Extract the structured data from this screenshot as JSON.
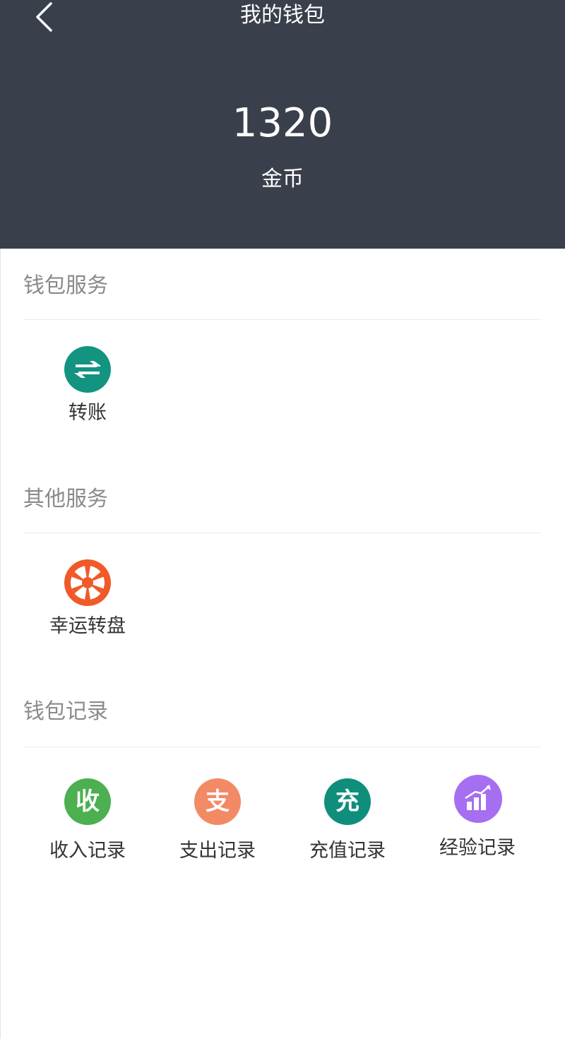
{
  "nav": {
    "title": "我的钱包",
    "back_icon": "chevron-left-icon"
  },
  "wallet": {
    "balance": "1320",
    "unit": "金币"
  },
  "sections": [
    {
      "title": "钱包服务",
      "items": [
        {
          "label": "转账",
          "icon": "transfer-icon",
          "color": "#129481"
        }
      ]
    },
    {
      "title": "其他服务",
      "items": [
        {
          "label": "幸运转盘",
          "icon": "wheel-icon",
          "color": "#f05a28"
        }
      ]
    },
    {
      "title": "钱包记录",
      "items": [
        {
          "label": "收入记录",
          "icon": "income-icon",
          "glyph": "收",
          "color": "#4caf50"
        },
        {
          "label": "支出记录",
          "icon": "expense-icon",
          "glyph": "支",
          "color": "#f28a66"
        },
        {
          "label": "充值记录",
          "icon": "recharge-icon",
          "glyph": "充",
          "color": "#0f8e7c"
        },
        {
          "label": "经验记录",
          "icon": "bar-chart-icon",
          "color": "#a66ef0"
        }
      ]
    }
  ],
  "colors": {
    "header_bg": "#3a3f4c",
    "section_title": "#8a8a8a",
    "label": "#333333"
  }
}
